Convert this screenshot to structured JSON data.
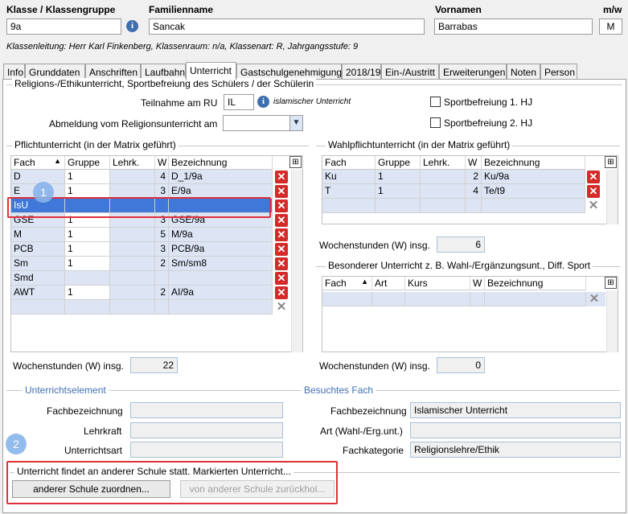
{
  "header": {
    "klasse_label": "Klasse / Klassengruppe",
    "klasse_value": "9a",
    "familienname_label": "Familienname",
    "familienname_value": "Sancak",
    "vornamen_label": "Vornamen",
    "vornamen_value": "Barrabas",
    "mw_label": "m/w",
    "mw_value": "M",
    "info_line": "Klassenleitung: Herr Karl Finkenberg, Klassenraum: n/a, Klassenart: R, Jahrgangsstufe: 9"
  },
  "tabs": [
    "Info",
    "Grunddaten",
    "Anschriften",
    "Laufbahn",
    "Unterricht",
    "Gastschulgenehmigung",
    "2018/19",
    "Ein-/Austritt",
    "Erweiterungen",
    "Noten",
    "Person"
  ],
  "religion": {
    "title": "Religions-/Ethikunterricht, Sportbefreiung des Schülers / der Schülerin",
    "teilnahme_label": "Teilnahme am RU",
    "teilnahme_value": "IL",
    "teilnahme_desc": "islamischer Unterricht",
    "abmeldung_label": "Abmeldung vom Religionsunterricht am",
    "sport1": "Sportbefreiung 1. HJ",
    "sport2": "Sportbefreiung 2. HJ"
  },
  "pflicht": {
    "title": "Pflichtunterricht (in der Matrix geführt)",
    "headers": [
      "Fach",
      "Gruppe",
      "Lehrk.",
      "W",
      "Bezeichnung"
    ],
    "rows": [
      {
        "fach": "D",
        "gruppe": "1",
        "lehrk": "",
        "w": "4",
        "bez": "D_1/9a"
      },
      {
        "fach": "E",
        "gruppe": "1",
        "lehrk": "",
        "w": "3",
        "bez": "E/9a"
      },
      {
        "fach": "IsU",
        "gruppe": "",
        "lehrk": "",
        "w": "",
        "bez": ""
      },
      {
        "fach": "GSE",
        "gruppe": "1",
        "lehrk": "",
        "w": "3",
        "bez": "GSE/9a"
      },
      {
        "fach": "M",
        "gruppe": "1",
        "lehrk": "",
        "w": "5",
        "bez": "M/9a"
      },
      {
        "fach": "PCB",
        "gruppe": "1",
        "lehrk": "",
        "w": "3",
        "bez": "PCB/9a"
      },
      {
        "fach": "Sm",
        "gruppe": "1",
        "lehrk": "",
        "w": "2",
        "bez": "Sm/sm8"
      },
      {
        "fach": "Smd",
        "gruppe": "",
        "lehrk": "",
        "w": "",
        "bez": ""
      },
      {
        "fach": "AWT",
        "gruppe": "1",
        "lehrk": "",
        "w": "2",
        "bez": "AI/9a"
      },
      {
        "fach": "",
        "gruppe": "",
        "lehrk": "",
        "w": "",
        "bez": ""
      }
    ],
    "wochen_label": "Wochenstunden (W) insg.",
    "wochen_value": "22"
  },
  "wahlpflicht": {
    "title": "Wahlpflichtunterricht (in der Matrix geführt)",
    "headers": [
      "Fach",
      "Gruppe",
      "Lehrk.",
      "W",
      "Bezeichnung"
    ],
    "rows": [
      {
        "fach": "Ku",
        "gruppe": "1",
        "lehrk": "",
        "w": "2",
        "bez": "Ku/9a"
      },
      {
        "fach": "T",
        "gruppe": "1",
        "lehrk": "",
        "w": "4",
        "bez": "Te/t9"
      },
      {
        "fach": "",
        "gruppe": "",
        "lehrk": "",
        "w": "",
        "bez": ""
      }
    ],
    "wochen_label": "Wochenstunden (W) insg.",
    "wochen_value": "6"
  },
  "besonderer": {
    "title": "Besonderer Unterricht z. B. Wahl-/Ergänzungsunt., Diff. Sport",
    "headers": [
      "Fach",
      "Art",
      "Kurs",
      "W",
      "Bezeichnung"
    ],
    "wochen_label": "Wochenstunden (W) insg.",
    "wochen_value": "0"
  },
  "unterrichtselement": {
    "title": "Unterrichtselement",
    "fachbezeichnung_label": "Fachbezeichnung",
    "lehrkraft_label": "Lehrkraft",
    "unterrichtsart_label": "Unterrichtsart"
  },
  "besuchtes_fach": {
    "title": "Besuchtes Fach",
    "fachbezeichnung_label": "Fachbezeichnung",
    "fachbezeichnung_value": "Islamischer Unterricht",
    "art_label": "Art (Wahl-/Erg.unt.)",
    "fachkategorie_label": "Fachkategorie",
    "fachkategorie_value": "Religionslehre/Ethik"
  },
  "andere_schule": {
    "title": "Unterricht findet an anderer Schule statt. Markierten Unterricht...",
    "zuordnen_label": "anderer Schule zuordnen...",
    "zurueck_label": "von anderer Schule zurückhol..."
  },
  "badges": [
    "1",
    "2"
  ],
  "colors": {
    "accent": "#3f6fae",
    "selection": "#3f78d8",
    "highlight": "#e0303a",
    "delete": "#d42a2a"
  }
}
